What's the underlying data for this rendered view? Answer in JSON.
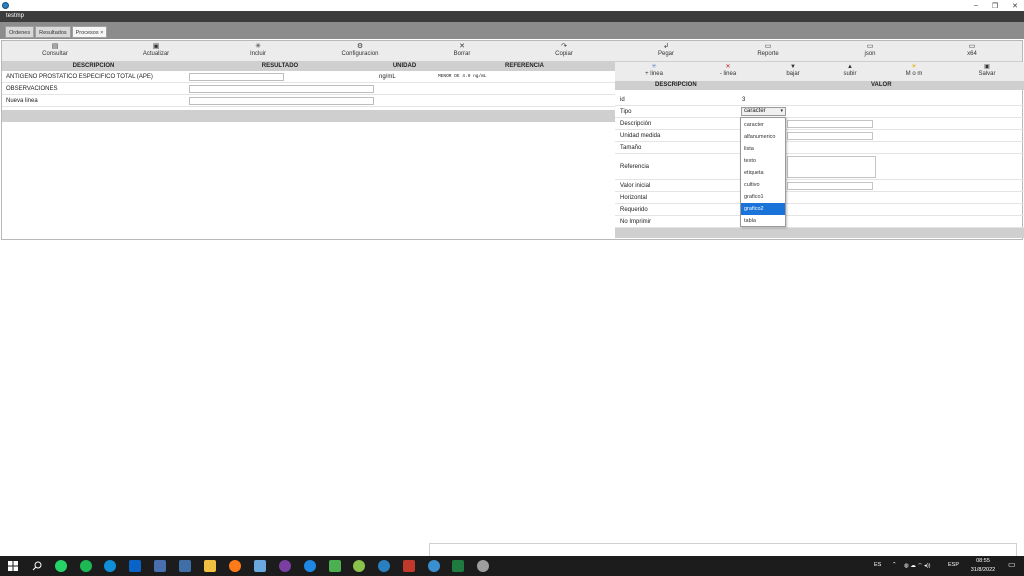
{
  "window": {
    "title": "testmp",
    "controls": {
      "minimize": "–",
      "maximize": "❐",
      "close": "✕"
    }
  },
  "tabs": [
    {
      "label": "Ordenes"
    },
    {
      "label": "Resultados"
    },
    {
      "label": "Procesos ×"
    }
  ],
  "toolbar": [
    {
      "label": "Consultar",
      "icon": "query-icon",
      "glyph": "▤"
    },
    {
      "label": "Actualizar",
      "icon": "refresh-icon",
      "glyph": "▣"
    },
    {
      "label": "Incluir",
      "icon": "add-icon",
      "glyph": "✳"
    },
    {
      "label": "Configuracion",
      "icon": "settings-icon",
      "glyph": "⚙"
    },
    {
      "label": "Borrar",
      "icon": "delete-icon",
      "glyph": "✕"
    },
    {
      "label": "Copiar",
      "icon": "copy-icon",
      "glyph": "↷"
    },
    {
      "label": "Pegar",
      "icon": "paste-icon",
      "glyph": "↲"
    },
    {
      "label": "Reporte",
      "icon": "print-icon",
      "glyph": "▭"
    },
    {
      "label": "json",
      "icon": "json-print-icon",
      "glyph": "▭"
    },
    {
      "label": "x64",
      "icon": "x64-print-icon",
      "glyph": "▭"
    }
  ],
  "left_table": {
    "headers": [
      "DESCRIPCION",
      "RESULTADO",
      "UNIDAD",
      "REFERENCIA"
    ],
    "rows": [
      {
        "descripcion": "ANTIGENO PROSTATICO ESPECIFICO TOTAL (APE)",
        "resultado": "",
        "unidad": "ng/mL",
        "referencia": "MENOR DE 4.0 ng/mL"
      },
      {
        "descripcion": "OBSERVACIONES",
        "resultado": "",
        "unidad": "",
        "referencia": ""
      },
      {
        "descripcion": "Nueva linea",
        "resultado": "",
        "unidad": "",
        "referencia": ""
      }
    ]
  },
  "right_toolbar": [
    {
      "label": "+ linea",
      "icon": "add-line-icon",
      "glyph": "✳"
    },
    {
      "label": "- linea",
      "icon": "remove-line-icon",
      "glyph": "✕"
    },
    {
      "label": "bajar",
      "icon": "move-down-icon",
      "glyph": "▼"
    },
    {
      "label": "subir",
      "icon": "move-up-icon",
      "glyph": "▲"
    },
    {
      "label": "M o m",
      "icon": "sun-icon",
      "glyph": "☀"
    },
    {
      "label": "Salvar",
      "icon": "save-icon",
      "glyph": "▣"
    }
  ],
  "properties": {
    "headers": [
      "DESCRIPCION",
      "VALOR"
    ],
    "rows": [
      {
        "label": "id",
        "value": "3"
      },
      {
        "label": "Tipo",
        "value": ""
      },
      {
        "label": "Descripción",
        "value": ""
      },
      {
        "label": "Unidad medida",
        "value": ""
      },
      {
        "label": "Tamaño",
        "value": ""
      },
      {
        "label": "Referencia",
        "value": ""
      },
      {
        "label": "Valor inicial",
        "value": ""
      },
      {
        "label": "Horizontal",
        "value": ""
      },
      {
        "label": "Requerido",
        "value": ""
      },
      {
        "label": "No Imprimir",
        "value": ""
      }
    ]
  },
  "tipo_select": {
    "selected": "caracter",
    "options": [
      "caracter",
      "alfanumerico",
      "lista",
      "texto",
      "etiqueta",
      "cultivo",
      "grafico1",
      "grafico2",
      "tabla"
    ],
    "highlighted": "grafico2"
  },
  "taskbar": {
    "tray": {
      "lang": "ES",
      "kbd": "ESP",
      "time": "08:55",
      "date": "31/8/2022"
    }
  },
  "colors": {
    "selection": "#1a73d9",
    "header_bg": "#cfcfcf",
    "taskbar": "#1c1c1c"
  }
}
